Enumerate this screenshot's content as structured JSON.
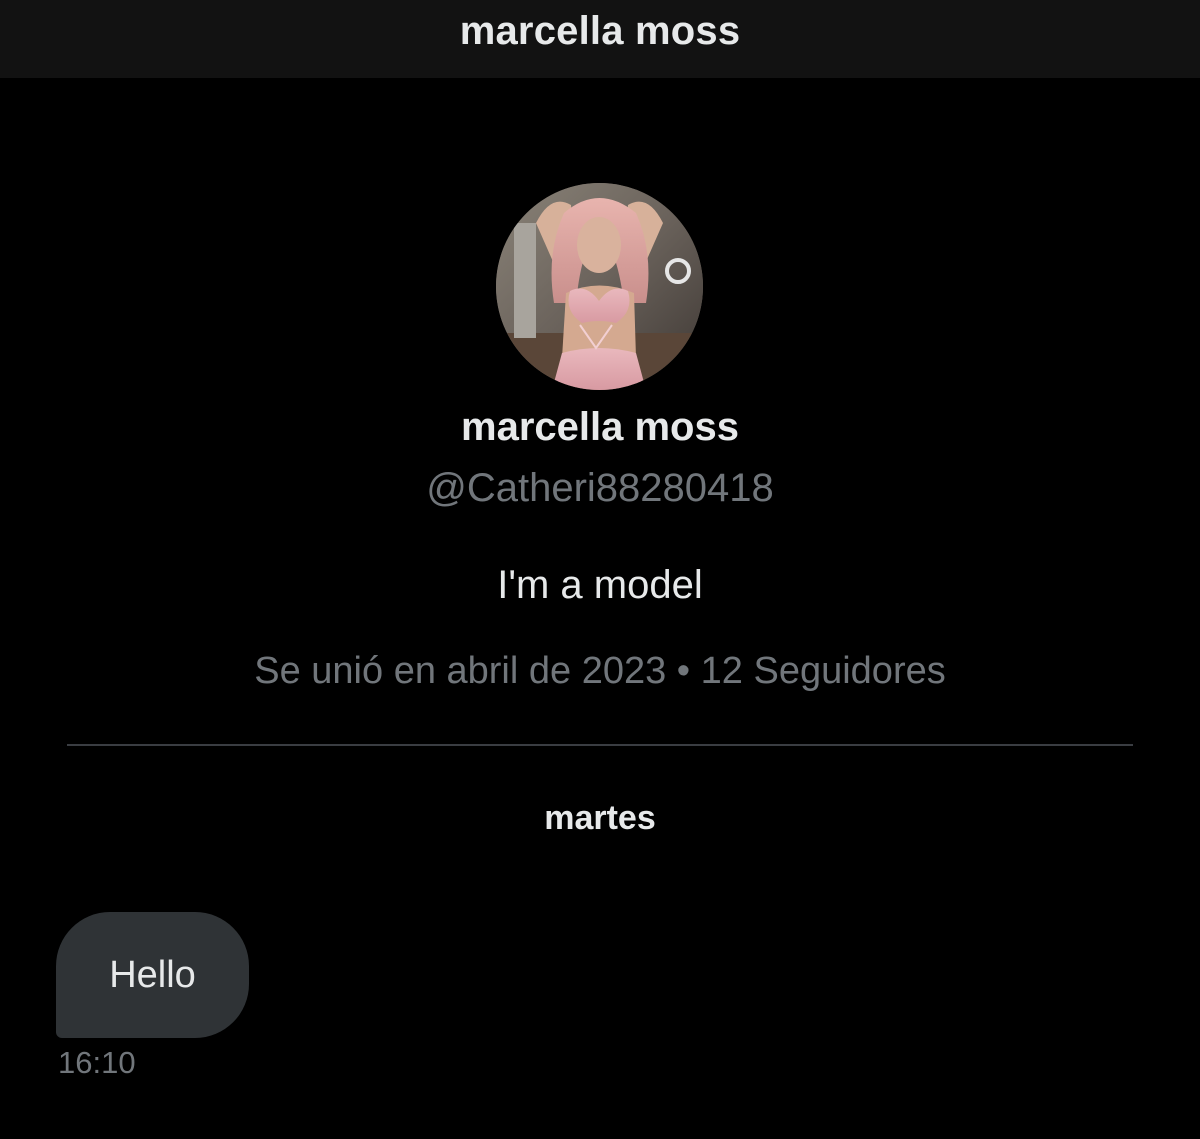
{
  "header": {
    "title": "marcella moss"
  },
  "profile": {
    "avatar_alt": "profile photo",
    "display_name": "marcella moss",
    "handle": "@Catheri88280418",
    "bio": "I'm a model",
    "meta": "Se unió en abril de 2023 • 12 Seguidores"
  },
  "conversation": {
    "day_label": "martes",
    "messages": [
      {
        "text": "Hello",
        "time": "16:10",
        "direction": "incoming"
      }
    ]
  },
  "colors": {
    "background": "#000000",
    "header_background": "#121212",
    "primary_text": "#e7e9ea",
    "secondary_text": "#71767b",
    "bubble_incoming": "#2f3336",
    "divider": "#3a3d42"
  }
}
